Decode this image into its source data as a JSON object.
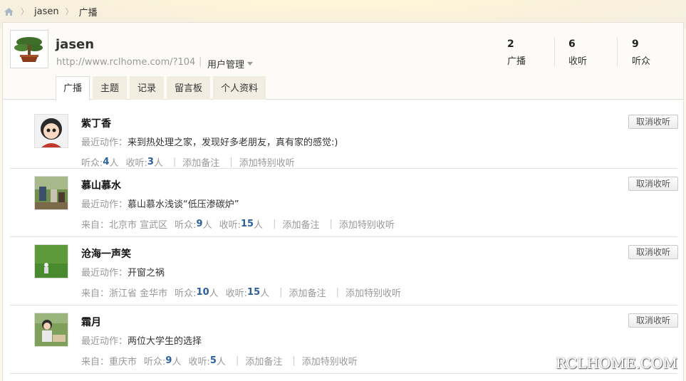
{
  "breadcrumb": {
    "home_icon": "home-icon",
    "items": [
      "jasen",
      "广播"
    ]
  },
  "profile": {
    "username": "jasen",
    "url": "http://www.rclhome.com/?104",
    "user_mgmt": "用户管理",
    "stats": [
      {
        "num": "2",
        "label": "广播"
      },
      {
        "num": "6",
        "label": "收听"
      },
      {
        "num": "9",
        "label": "听众"
      }
    ]
  },
  "tabs": [
    "广播",
    "主题",
    "记录",
    "留言板",
    "个人资料"
  ],
  "follow": {
    "unfollow_label": "取消收听",
    "recent_prefix": "最近动作：",
    "from_prefix": "来自：",
    "fans_prefix": "听众:",
    "follows_prefix": "收听:",
    "unit": "人",
    "add_note": "添加备注",
    "add_special": "添加特别收听",
    "items": [
      {
        "name": "紫丁香",
        "action": "来到热处理之家，发现好多老朋友，真有家的感觉:)",
        "from": "",
        "fans": "4",
        "follows": "3"
      },
      {
        "name": "慕山慕水",
        "action": "慕山慕水浅谈“低压渗碳炉”",
        "from": "北京市 宣武区",
        "fans": "9",
        "follows": "15"
      },
      {
        "name": "沧海一声笑",
        "action": "开窗之祸",
        "from": "浙江省 金华市",
        "fans": "10",
        "follows": "15"
      },
      {
        "name": "霜月",
        "action": "两位大学生的选择",
        "from": "重庆市",
        "fans": "9",
        "follows": "5"
      }
    ]
  },
  "watermark": "RCLHOME.COM"
}
